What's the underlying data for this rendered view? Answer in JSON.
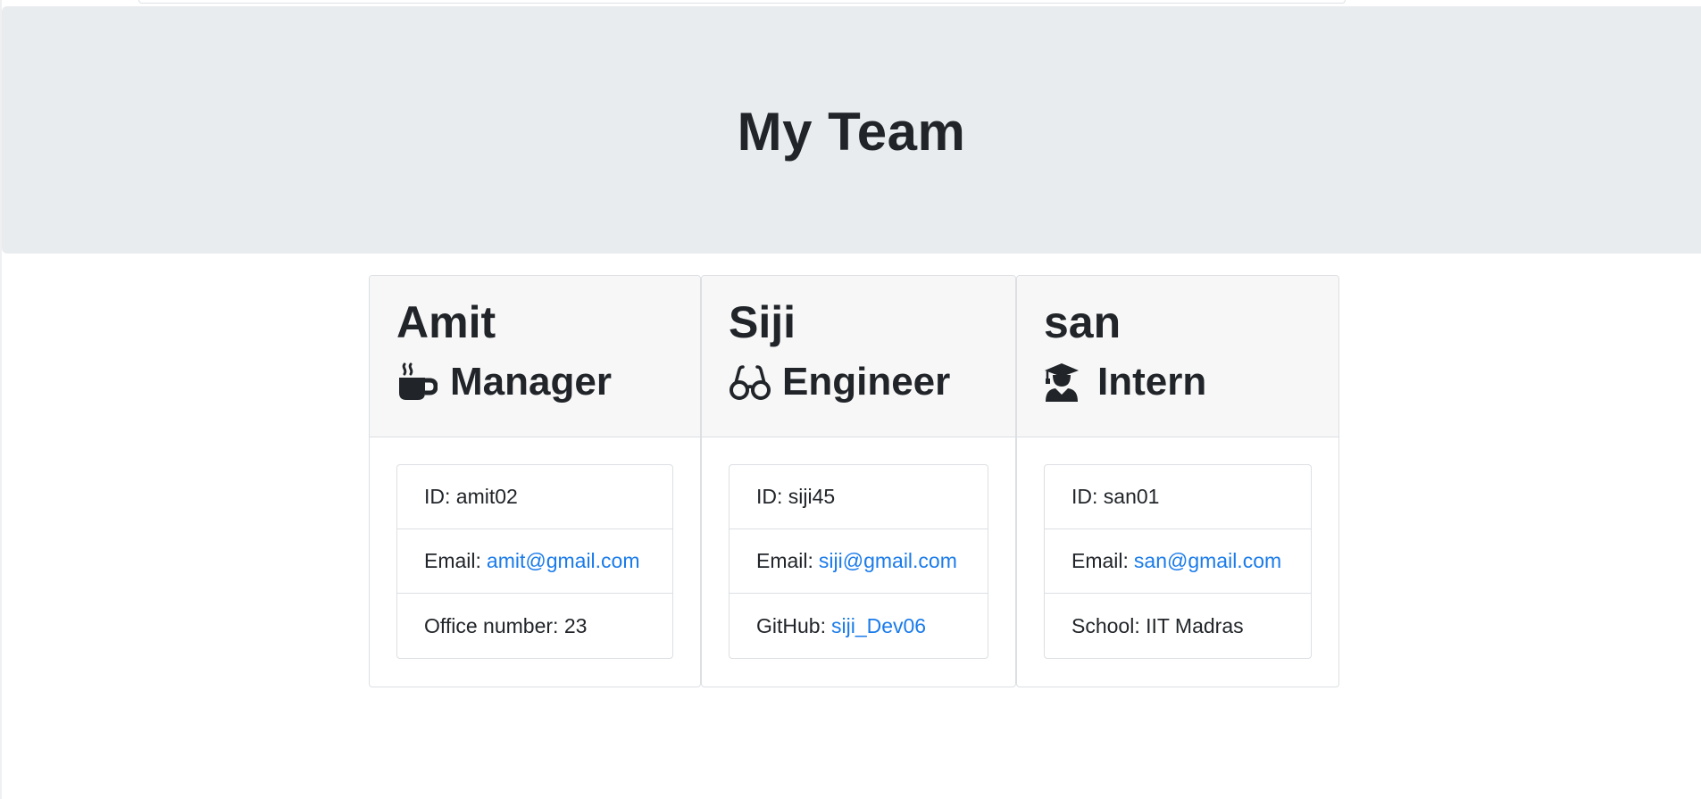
{
  "page": {
    "title": "My Team"
  },
  "colors": {
    "jumbotron_bg": "#e9ecef",
    "card_header_bg": "#f7f7f7",
    "link": "#1a7bea",
    "text": "#212529"
  },
  "team": [
    {
      "name": "Amit",
      "role": "Manager",
      "role_icon": "mug-hot-icon",
      "id_label": "ID:",
      "id_value": "amit02",
      "email_label": "Email:",
      "email": "amit@gmail.com",
      "extra_label": "Office number:",
      "extra_value": "23"
    },
    {
      "name": "Siji",
      "role": "Engineer",
      "role_icon": "glasses-icon",
      "id_label": "ID:",
      "id_value": "siji45",
      "email_label": "Email:",
      "email": "siji@gmail.com",
      "extra_label": "GitHub:",
      "extra_value": "siji_Dev06"
    },
    {
      "name": "san",
      "role": "Intern",
      "role_icon": "user-graduate-icon",
      "id_label": "ID:",
      "id_value": "san01",
      "email_label": "Email:",
      "email": "san@gmail.com",
      "extra_label": "School:",
      "extra_value": "IIT Madras"
    }
  ]
}
